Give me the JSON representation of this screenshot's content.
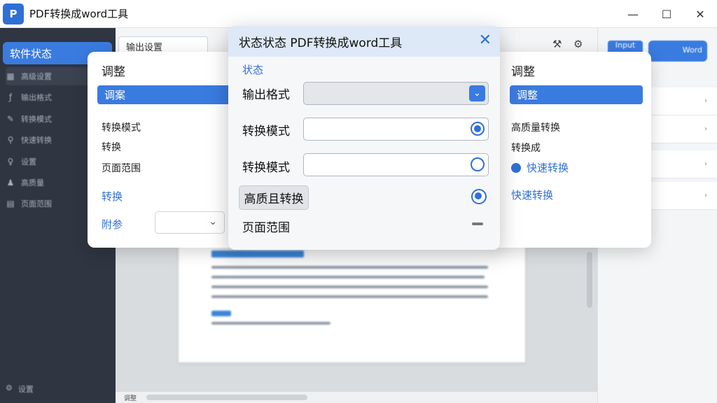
{
  "app": {
    "icon_label": "P",
    "title": "PDF转换成word工具"
  },
  "window_controls": {
    "minimize": "—",
    "maximize": "☐",
    "close": "✕"
  },
  "sidebar": {
    "active_label": "软件状态",
    "items": [
      {
        "label": "高级设置",
        "icon": "grid-icon"
      },
      {
        "label": "输出格式",
        "icon": "f-icon"
      },
      {
        "label": "转换模式",
        "icon": "wrench-icon"
      },
      {
        "label": "快速转换",
        "icon": "pin-icon"
      },
      {
        "label": "设置",
        "icon": "bulb-icon"
      },
      {
        "label": "高质量",
        "icon": "people-icon"
      },
      {
        "label": "页面范围",
        "icon": "doc-icon"
      }
    ],
    "bottom_label": "设置"
  },
  "main": {
    "tab_label": "输出设置",
    "status_label": "调整"
  },
  "left_card": {
    "title": "调整",
    "selected": "调案",
    "lines": [
      "转换模式",
      "转换",
      "页面范围"
    ],
    "link": "转换",
    "footer_label": "附参"
  },
  "right_card": {
    "title": "调整",
    "selected": "调整",
    "lines": [
      "高质量转换",
      "转换成"
    ],
    "option_selected": "快速转换",
    "link": "快速转换"
  },
  "dialog": {
    "title": "状态状态 PDF转换成word工具",
    "subtitle": "状态",
    "output_format_label": "输出格式",
    "mode_label_1": "转换模式",
    "mode_label_2": "转换模式",
    "hq_button": "高质且转换",
    "page_range_label": "页面范围",
    "radio1_selected": true,
    "radio2_selected": false,
    "radio3_selected": true
  },
  "right_panel": {
    "button1": "Input",
    "button2": "Word"
  },
  "colors": {
    "accent": "#3a7be0",
    "sidebar": "#2f3541",
    "dialog_header": "#dde9f7"
  }
}
